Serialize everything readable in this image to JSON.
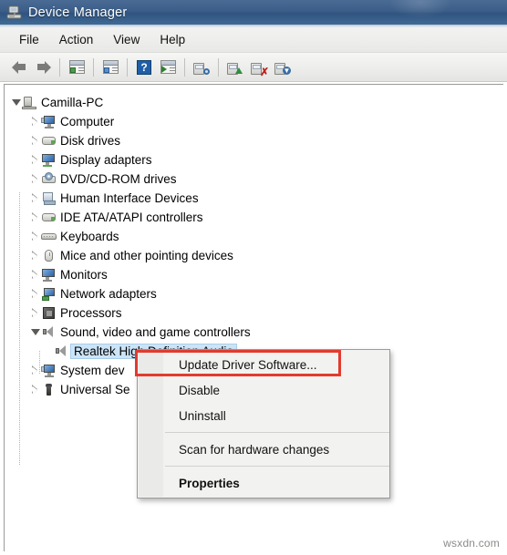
{
  "window": {
    "title": "Device Manager",
    "title_icon": "device-manager-icon"
  },
  "menubar": {
    "items": [
      {
        "label": "File"
      },
      {
        "label": "Action"
      },
      {
        "label": "View"
      },
      {
        "label": "Help"
      }
    ]
  },
  "toolbar": {
    "buttons": [
      {
        "name": "back-icon",
        "label": "Back"
      },
      {
        "name": "forward-icon",
        "label": "Forward"
      },
      {
        "name": "show-hide-console-tree-icon",
        "label": "Show/Hide Console Tree"
      },
      {
        "name": "properties-icon",
        "label": "Properties"
      },
      {
        "name": "help-icon",
        "label": "Help"
      },
      {
        "name": "view-icon",
        "label": "View"
      },
      {
        "name": "scan-for-hardware-changes-icon",
        "label": "Scan for hardware changes"
      },
      {
        "name": "update-driver-software-icon",
        "label": "Update Driver Software"
      },
      {
        "name": "disable-device-icon",
        "label": "Disable"
      },
      {
        "name": "uninstall-device-icon",
        "label": "Uninstall"
      }
    ]
  },
  "tree": {
    "root": {
      "label": "Camilla-PC",
      "icon": "computer-root-icon",
      "expanded": true
    },
    "items": [
      {
        "label": "Computer",
        "icon": "computer-icon",
        "expanded": false,
        "indent": 1
      },
      {
        "label": "Disk drives",
        "icon": "disk-drive-icon",
        "expanded": false,
        "indent": 1
      },
      {
        "label": "Display adapters",
        "icon": "display-adapter-icon",
        "expanded": false,
        "indent": 1
      },
      {
        "label": "DVD/CD-ROM drives",
        "icon": "dvd-drive-icon",
        "expanded": false,
        "indent": 1
      },
      {
        "label": "Human Interface Devices",
        "icon": "hid-icon",
        "expanded": false,
        "indent": 1
      },
      {
        "label": "IDE ATA/ATAPI controllers",
        "icon": "ide-controller-icon",
        "expanded": false,
        "indent": 1
      },
      {
        "label": "Keyboards",
        "icon": "keyboard-icon",
        "expanded": false,
        "indent": 1
      },
      {
        "label": "Mice and other pointing devices",
        "icon": "mouse-icon",
        "expanded": false,
        "indent": 1
      },
      {
        "label": "Monitors",
        "icon": "monitor-icon",
        "expanded": false,
        "indent": 1
      },
      {
        "label": "Network adapters",
        "icon": "network-adapter-icon",
        "expanded": false,
        "indent": 1
      },
      {
        "label": "Processors",
        "icon": "processor-icon",
        "expanded": false,
        "indent": 1
      },
      {
        "label": "Sound, video and game controllers",
        "icon": "sound-controller-icon",
        "expanded": true,
        "indent": 1
      },
      {
        "label": "Realtek High Definition Audio",
        "icon": "audio-device-icon",
        "expanded": false,
        "indent": 2,
        "selected": true
      },
      {
        "label": "System dev",
        "icon": "system-device-icon",
        "expanded": false,
        "indent": 1
      },
      {
        "label": "Universal Se",
        "icon": "usb-controller-icon",
        "expanded": false,
        "indent": 1
      }
    ]
  },
  "context_menu": {
    "items": [
      {
        "label": "Update Driver Software...",
        "bold": false,
        "highlighted": true
      },
      {
        "label": "Disable",
        "bold": false
      },
      {
        "label": "Uninstall",
        "bold": false
      },
      {
        "separator": true
      },
      {
        "label": "Scan for hardware changes",
        "bold": false
      },
      {
        "separator": true
      },
      {
        "label": "Properties",
        "bold": true
      }
    ]
  },
  "annotation": {
    "highlight_color": "#e23b2e",
    "target": "Update Driver Software..."
  },
  "watermark": {
    "text": "wsxdn.com"
  }
}
